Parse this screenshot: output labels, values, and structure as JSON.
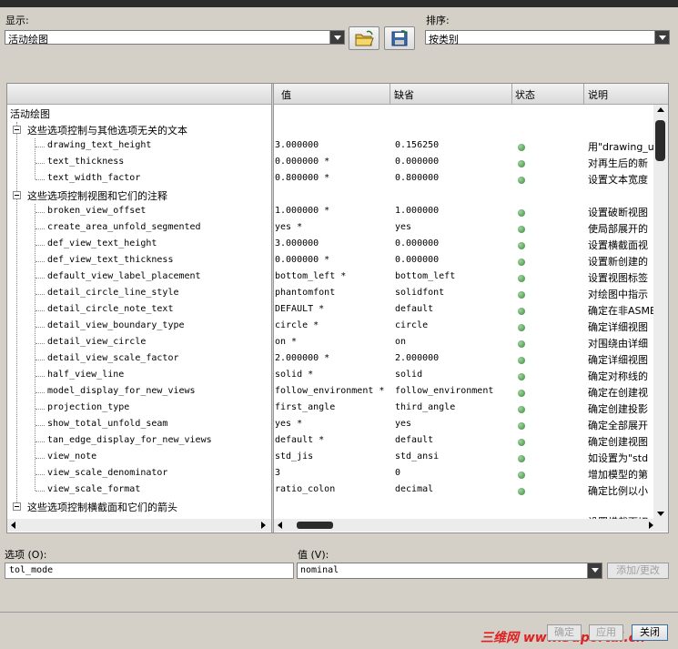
{
  "show_label": "显示:",
  "show_value": "活动绘图",
  "sort_label": "排序:",
  "sort_value": "按类别",
  "columns": {
    "value": "值",
    "default": "缺省",
    "status": "状态",
    "desc": "说明"
  },
  "root_label": "活动绘图",
  "categories": [
    "这些选项控制与其他选项无关的文本",
    "这些选项控制视图和它们的注释",
    "这些选项控制横截面和它们的箭头"
  ],
  "rows": [
    {
      "name": "drawing_text_height",
      "value": "3.000000",
      "default": "0.156250",
      "desc": "用\"drawing_u"
    },
    {
      "name": "text_thickness",
      "value": "0.000000 *",
      "default": "0.000000",
      "desc": "对再生后的新"
    },
    {
      "name": "text_width_factor",
      "value": "0.800000 *",
      "default": "0.800000",
      "desc": "设置文本宽度"
    },
    {
      "name": "broken_view_offset",
      "value": "1.000000 *",
      "default": "1.000000",
      "desc": "设置破断视图"
    },
    {
      "name": "create_area_unfold_segmented",
      "value": "yes *",
      "default": "yes",
      "desc": "使局部展开的"
    },
    {
      "name": "def_view_text_height",
      "value": "3.000000",
      "default": "0.000000",
      "desc": "设置横截面视"
    },
    {
      "name": "def_view_text_thickness",
      "value": "0.000000 *",
      "default": "0.000000",
      "desc": "设置新创建的"
    },
    {
      "name": "default_view_label_placement",
      "value": "bottom_left *",
      "default": "bottom_left",
      "desc": "设置视图标签"
    },
    {
      "name": "detail_circle_line_style",
      "value": "phantomfont",
      "default": "solidfont",
      "desc": "对绘图中指示"
    },
    {
      "name": "detail_circle_note_text",
      "value": "DEFAULT *",
      "default": "default",
      "desc": "确定在非ASME"
    },
    {
      "name": "detail_view_boundary_type",
      "value": "circle *",
      "default": "circle",
      "desc": "确定详细视图"
    },
    {
      "name": "detail_view_circle",
      "value": "on *",
      "default": "on",
      "desc": "对围绕由详细"
    },
    {
      "name": "detail_view_scale_factor",
      "value": "2.000000 *",
      "default": "2.000000",
      "desc": "确定详细视图"
    },
    {
      "name": "half_view_line",
      "value": "solid *",
      "default": "solid",
      "desc": "确定对称线的"
    },
    {
      "name": "model_display_for_new_views",
      "value": "follow_environment *",
      "default": "follow_environment",
      "desc": "确定在创建视"
    },
    {
      "name": "projection_type",
      "value": "first_angle",
      "default": "third_angle",
      "desc": "确定创建投影"
    },
    {
      "name": "show_total_unfold_seam",
      "value": "yes *",
      "default": "yes",
      "desc": "确定全部展开"
    },
    {
      "name": "tan_edge_display_for_new_views",
      "value": "default *",
      "default": "default",
      "desc": "确定创建视图"
    },
    {
      "name": "view_note",
      "value": "std_jis",
      "default": "std_ansi",
      "desc": "如设置为\"std"
    },
    {
      "name": "view_scale_denominator",
      "value": "3",
      "default": "0",
      "desc": "增加模型的第"
    },
    {
      "name": "view_scale_format",
      "value": "ratio_colon",
      "default": "decimal",
      "desc": "确定比例以小"
    }
  ],
  "partial_desc": "设置横截面切",
  "option_label": "选项 (O):",
  "option_value": "tol_mode",
  "value_label": "值 (V):",
  "value_value": "nominal",
  "add_change_label": "添加/更改",
  "ok_label": "确定",
  "apply_label": "应用",
  "close_label": "关闭",
  "watermark": "三维网 www.3dportal.cn",
  "colors": {
    "status_ok": "#3a8a3a",
    "watermark": "#e02020"
  },
  "icons": [
    "open-folder-icon",
    "save-config-icon"
  ]
}
